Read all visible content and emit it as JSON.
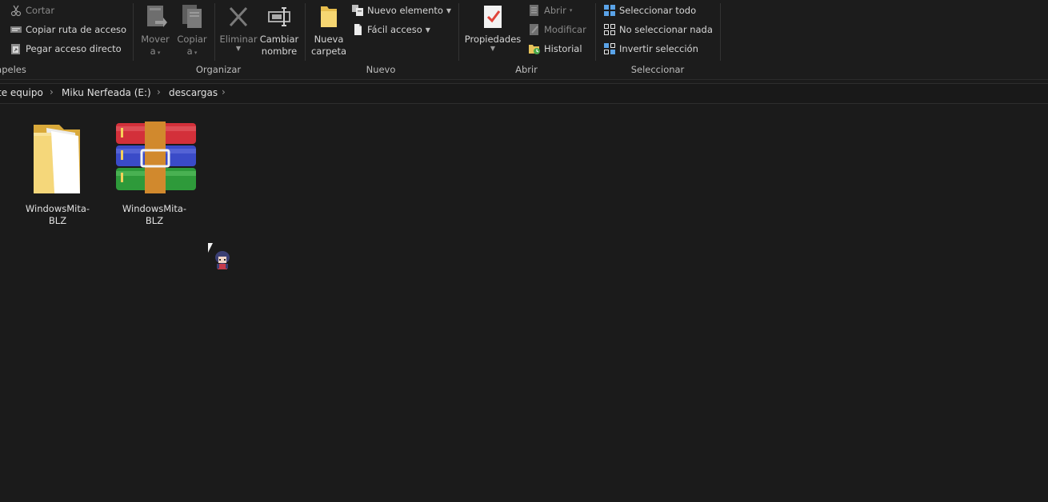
{
  "ribbon": {
    "clipboard": {
      "cut": "Cortar",
      "copy_path": "Copiar ruta de acceso",
      "paste_shortcut": "Pegar acceso directo",
      "group": "apeles"
    },
    "organize": {
      "move_line1": "Mover",
      "move_line2": "a",
      "copy_line1": "Copiar",
      "copy_line2": "a",
      "delete": "Eliminar",
      "rename_line1": "Cambiar",
      "rename_line2": "nombre",
      "group": "Organizar"
    },
    "new": {
      "folder_line1": "Nueva",
      "folder_line2": "carpeta",
      "new_item": "Nuevo elemento",
      "easy_access": "Fácil acceso",
      "group": "Nuevo"
    },
    "open": {
      "properties": "Propiedades",
      "open": "Abrir",
      "edit": "Modificar",
      "history": "Historial",
      "group": "Abrir"
    },
    "select": {
      "select_all": "Seleccionar todo",
      "select_none": "No seleccionar nada",
      "invert": "Invertir selección",
      "group": "Seleccionar"
    }
  },
  "breadcrumb": {
    "items": [
      "te equipo",
      "Miku Nerfeada (E:)",
      "descargas"
    ]
  },
  "files": [
    {
      "name_line1": "WindowsMita-",
      "name_line2": "BLZ",
      "type": "folder-icon"
    },
    {
      "name_line1": "WindowsMita-",
      "name_line2": "BLZ",
      "type": "winrar-archive-icon"
    }
  ],
  "colors": {
    "background": "#1b1b1b",
    "folder": "#f3cf66",
    "winrar_red": "#d3303a",
    "winrar_blue": "#3a4bc8",
    "winrar_green": "#2e9a3a",
    "winrar_belt": "#d1892d"
  }
}
